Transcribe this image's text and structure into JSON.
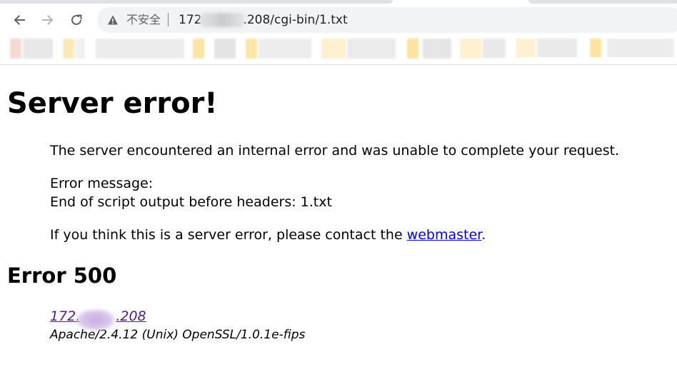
{
  "toolbar": {
    "back_icon": "arrow-left-icon",
    "forward_icon": "arrow-right-icon",
    "reload_icon": "reload-icon",
    "security_icon": "warning-triangle-icon",
    "security_label": "不安全",
    "url_prefix": "172",
    "url_suffix": ".208/cgi-bin/1.txt"
  },
  "bookmarks_bar": {
    "state": "blurred"
  },
  "page": {
    "title": "Server error!",
    "intro": "The server encountered an internal error and was unable to complete your request.",
    "error_message_label": "Error message:",
    "error_message_detail": "End of script output before headers: 1.txt",
    "contact_prefix": "If you think this is a server error, please contact the ",
    "contact_link": "webmaster",
    "contact_suffix": ".",
    "error_heading": "Error 500",
    "host_prefix": "172.",
    "host_suffix": ".208",
    "server_signature": "Apache/2.4.12 (Unix) OpenSSL/1.0.1e-fips"
  },
  "colors": {
    "link": "#0000ee",
    "visited_link": "#551a8b",
    "omnibox_bg": "#f1f3f4"
  }
}
